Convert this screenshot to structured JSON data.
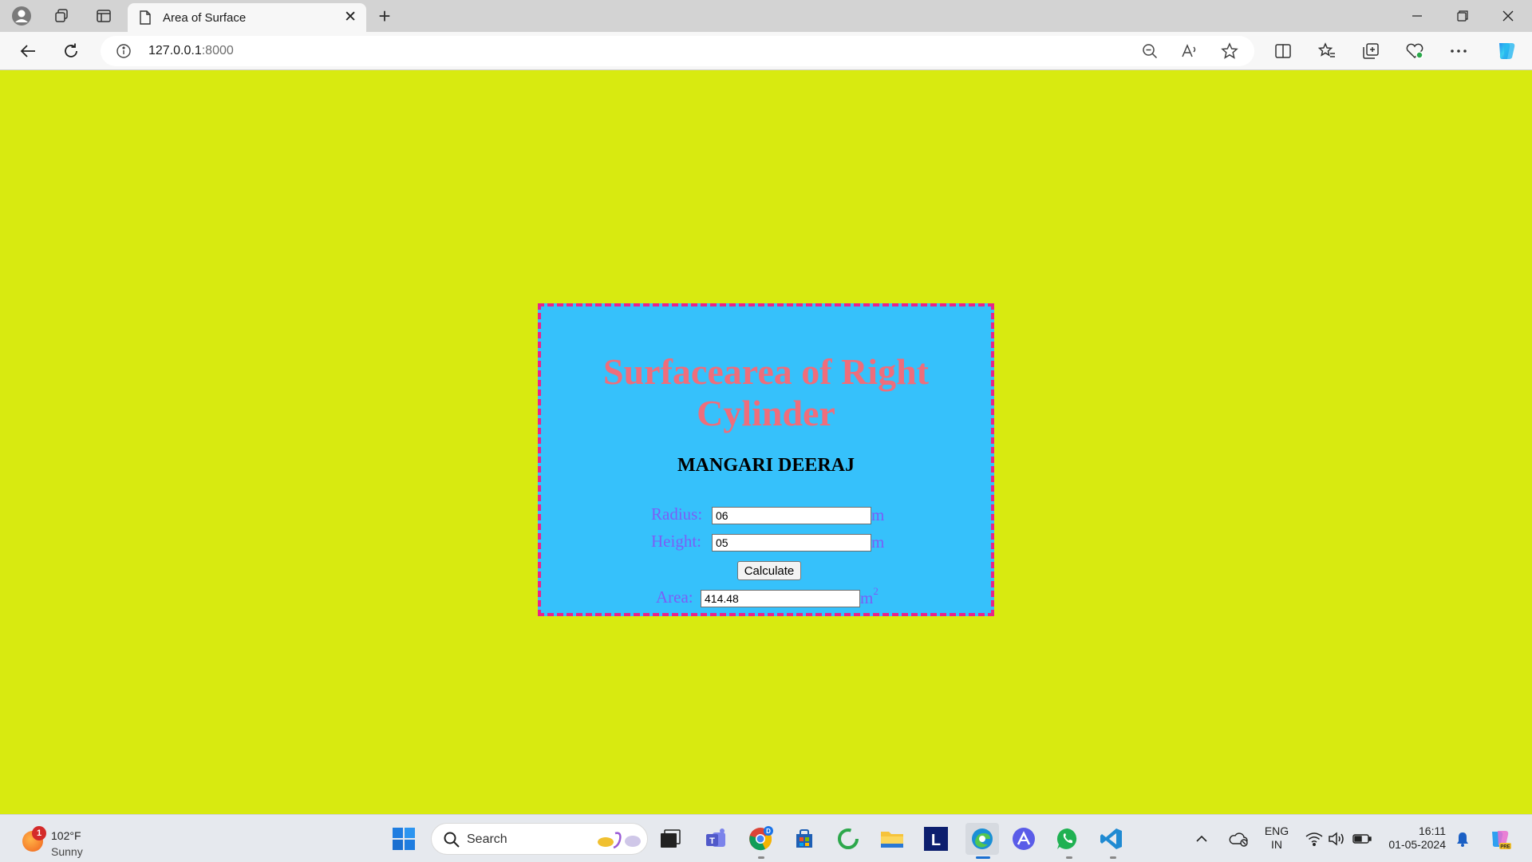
{
  "browser": {
    "tab_title": "Area of Surface",
    "close_glyph": "✕",
    "new_tab_glyph": "+",
    "url_host": "127.0.0.1",
    "url_port": ":8000"
  },
  "page": {
    "title": "Surfacearea of Right Cylinder",
    "author": "MANGARI DEERAJ",
    "radius_label": "Radius:",
    "radius_value": "06",
    "radius_unit": "m",
    "height_label": "Height:",
    "height_value": "05",
    "height_unit": "m",
    "calculate_label": "Calculate",
    "area_label": "Area:",
    "area_value": "414.48",
    "area_unit": "m",
    "area_unit_sup": "2"
  },
  "taskbar": {
    "weather_badge": "1",
    "weather_temp": "102°F",
    "weather_condition": "Sunny",
    "search_label": "Search",
    "lang_top": "ENG",
    "lang_bottom": "IN",
    "time": "16:11",
    "date": "01-05-2024"
  },
  "colors": {
    "page_background": "#d8ea10",
    "card_background": "#36c1fb",
    "card_border": "#e8248b",
    "title_color": "#ef6d7b",
    "label_color": "#7b5ef6"
  }
}
